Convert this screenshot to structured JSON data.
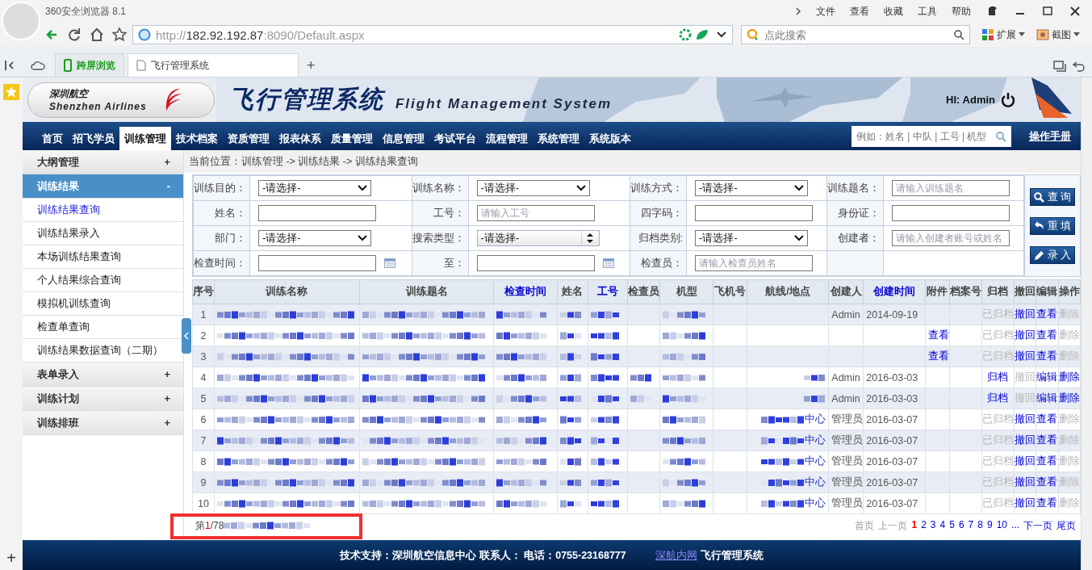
{
  "browser": {
    "title": "360安全浏览器 8.1",
    "menu": [
      "文件",
      "查看",
      "收藏",
      "工具",
      "帮助"
    ],
    "url": {
      "scheme": "http://",
      "host": "182.92.192.87",
      "rest": ":8090/Default.aspx"
    },
    "search": {
      "placeholder": "点此搜索"
    },
    "tools": [
      "扩展",
      "截图"
    ],
    "tabs": [
      {
        "label": "跨屏浏览",
        "kind": "special",
        "selected": false
      },
      {
        "label": "飞行管理系统",
        "kind": "page",
        "selected": true
      }
    ],
    "new_tab": "+",
    "side_plus": "+"
  },
  "header": {
    "logo_cn": "深圳航空",
    "logo_en": "Shenzhen Airlines",
    "title_cn": "飞行管理系统",
    "title_en": "Flight Management System",
    "greeting": "HI: Admin"
  },
  "nav": {
    "items": [
      {
        "label": "首页",
        "selected": false
      },
      {
        "label": "招飞学员",
        "selected": false
      },
      {
        "label": "训练管理",
        "selected": true
      },
      {
        "label": "技术档案",
        "selected": false
      },
      {
        "label": "资质管理",
        "selected": false
      },
      {
        "label": "报表体系",
        "selected": false
      },
      {
        "label": "质量管理",
        "selected": false
      },
      {
        "label": "信息管理",
        "selected": false
      },
      {
        "label": "考试平台",
        "selected": false
      },
      {
        "label": "流程管理",
        "selected": false
      },
      {
        "label": "系统管理",
        "selected": false
      },
      {
        "label": "系统版本",
        "selected": false
      }
    ],
    "search_placeholder": "例如：姓名 | 中队 | 工号 | 机型",
    "manual": "操作手册"
  },
  "sidebar": [
    {
      "label": "大纲管理",
      "sign": "+",
      "expanded": false
    },
    {
      "label": "训练结果",
      "sign": "-",
      "expanded": true,
      "children": [
        {
          "label": "训练结果查询",
          "selected": true
        },
        {
          "label": "训练结果录入",
          "selected": false
        },
        {
          "label": "本场训练结果查询",
          "selected": false
        },
        {
          "label": "个人结果综合查询",
          "selected": false
        },
        {
          "label": "模拟机训练查询",
          "selected": false
        },
        {
          "label": "检查单查询",
          "selected": false
        },
        {
          "label": "训练结果数据查询（二期）",
          "selected": false
        }
      ]
    },
    {
      "label": "表单录入",
      "sign": "+",
      "expanded": false
    },
    {
      "label": "训练计划",
      "sign": "+",
      "expanded": false
    },
    {
      "label": "训练排班",
      "sign": "+",
      "expanded": false
    }
  ],
  "breadcrumb": "当前位置：训练管理 -> 训练结果 -> 训练结果查询",
  "form": {
    "rows": [
      [
        {
          "label": "训练目的：",
          "kind": "select",
          "value": "-请选择-"
        },
        {
          "label": "训练名称：",
          "kind": "select",
          "value": "-请选择-"
        },
        {
          "label": "训练方式：",
          "kind": "select",
          "value": "-请选择-"
        },
        {
          "label": "训练题名：",
          "kind": "text",
          "placeholder": "请输入训练题名"
        }
      ],
      [
        {
          "label": "姓名：",
          "kind": "text"
        },
        {
          "label": "工号：",
          "kind": "text",
          "placeholder": "请输入工号"
        },
        {
          "label": "四字码：",
          "kind": "text"
        },
        {
          "label": "身份证：",
          "kind": "text"
        }
      ],
      [
        {
          "label": "部门：",
          "kind": "select",
          "value": "-请选择-"
        },
        {
          "label": "搜索类型：",
          "kind": "spinner",
          "value": "-请选择-"
        },
        {
          "label": "归档类别:",
          "kind": "select",
          "value": "-请选择-"
        },
        {
          "label": "创建者：",
          "kind": "text",
          "placeholder": "请输入创建者账号或姓名"
        }
      ],
      [
        {
          "label": "检查时间：",
          "kind": "date"
        },
        {
          "label": "至：",
          "kind": "date"
        },
        {
          "label": "检查员：",
          "kind": "text",
          "placeholder": "请输入检查员姓名"
        }
      ]
    ],
    "buttons": [
      {
        "label": "查 询",
        "kind": "search"
      },
      {
        "label": "重 填",
        "kind": "reset"
      },
      {
        "label": "录 入",
        "kind": "edit"
      }
    ]
  },
  "table": {
    "columns": [
      {
        "label": "序号",
        "kind": "index",
        "link": false
      },
      {
        "label": "训练名称",
        "kind": "masked",
        "link": false
      },
      {
        "label": "训练题名",
        "kind": "masked",
        "link": false
      },
      {
        "label": "检查时间",
        "kind": "masked",
        "link": true
      },
      {
        "label": "姓名",
        "kind": "masked",
        "link": false
      },
      {
        "label": "工号",
        "kind": "masked",
        "link": true
      },
      {
        "label": "检查员",
        "kind": "inspector",
        "link": false
      },
      {
        "label": "机型",
        "kind": "masked",
        "link": false
      },
      {
        "label": "飞机号",
        "kind": "empty",
        "link": false
      },
      {
        "label": "航线/地点",
        "kind": "route",
        "link": false
      },
      {
        "label": "创建人",
        "kind": "creator",
        "link": false
      },
      {
        "label": "创建时间",
        "kind": "created",
        "link": true
      },
      {
        "label": "附件",
        "kind": "attachment",
        "link": false
      },
      {
        "label": "档案号",
        "kind": "empty",
        "link": false
      },
      {
        "label": "归档",
        "kind": "archive",
        "link": false
      },
      {
        "label": "撤回",
        "kind": "revoke",
        "link": false
      },
      {
        "label": "编辑",
        "kind": "edit",
        "link": false
      },
      {
        "label": "操作",
        "kind": "delete",
        "link": false
      }
    ],
    "rows": [
      {
        "no": "1",
        "inspector_masked": false,
        "route_masked": false,
        "creator": "Admin",
        "created": "2014-09-19",
        "archive": "已归档",
        "archive_enabled": false,
        "revoke": "撤回",
        "revoke_enabled": true,
        "edit": "查看",
        "delete": "删除",
        "delete_enabled": false
      },
      {
        "no": "2",
        "inspector_masked": false,
        "route_masked": false,
        "attachment": "查看",
        "archive": "已归档",
        "archive_enabled": false,
        "revoke": "撤回",
        "revoke_enabled": true,
        "edit": "查看",
        "delete": "删除",
        "delete_enabled": false
      },
      {
        "no": "3",
        "inspector_masked": false,
        "route_masked": false,
        "attachment": "查看",
        "archive": "已归档",
        "archive_enabled": false,
        "revoke": "撤回",
        "revoke_enabled": true,
        "edit": "查看",
        "delete": "删除",
        "delete_enabled": false
      },
      {
        "no": "4",
        "inspector_masked": true,
        "route_masked": true,
        "creator": "Admin",
        "created": "2016-03-03",
        "archive": "归档",
        "archive_enabled": true,
        "revoke": "撤回",
        "revoke_enabled": false,
        "edit": "编辑",
        "delete": "删除",
        "delete_enabled": true
      },
      {
        "no": "5",
        "inspector_masked": true,
        "route_masked": true,
        "creator": "Admin",
        "created": "2016-03-03",
        "archive": "归档",
        "archive_enabled": true,
        "revoke": "撤回",
        "revoke_enabled": false,
        "edit": "编辑",
        "delete": "删除",
        "delete_enabled": true
      },
      {
        "no": "6",
        "inspector_masked": false,
        "route_masked": true,
        "route": "中心",
        "creator": "管理员",
        "created": "2016-03-07",
        "archive": "已归档",
        "archive_enabled": false,
        "revoke": "撤回",
        "revoke_enabled": true,
        "edit": "查看",
        "delete": "删除",
        "delete_enabled": false
      },
      {
        "no": "7",
        "inspector_masked": false,
        "route_masked": true,
        "route": "中心",
        "creator": "管理员",
        "created": "2016-03-07",
        "archive": "已归档",
        "archive_enabled": false,
        "revoke": "撤回",
        "revoke_enabled": true,
        "edit": "查看",
        "delete": "删除",
        "delete_enabled": false
      },
      {
        "no": "8",
        "inspector_masked": false,
        "route_masked": true,
        "route": "中心",
        "creator": "管理员",
        "created": "2016-03-07",
        "archive": "已归档",
        "archive_enabled": false,
        "revoke": "撤回",
        "revoke_enabled": true,
        "edit": "查看",
        "delete": "删除",
        "delete_enabled": false
      },
      {
        "no": "9",
        "inspector_masked": false,
        "route_masked": true,
        "route": "中心",
        "creator": "管理员",
        "created": "2016-03-07",
        "archive": "已归档",
        "archive_enabled": false,
        "revoke": "撤回",
        "revoke_enabled": true,
        "edit": "查看",
        "delete": "删除",
        "delete_enabled": false
      },
      {
        "no": "10",
        "inspector_masked": false,
        "route_masked": true,
        "route": "中心",
        "creator": "管理员",
        "created": "2016-03-07",
        "archive": "已归档",
        "archive_enabled": false,
        "revoke": "撤回",
        "revoke_enabled": true,
        "edit": "查看",
        "delete": "删除",
        "delete_enabled": false
      }
    ]
  },
  "pagination": {
    "prefix": "第",
    "current": "1",
    "total": "/78",
    "links": [
      {
        "label": "首页",
        "selected": false,
        "disabled": true
      },
      {
        "label": "上一页",
        "selected": false,
        "disabled": true
      },
      {
        "label": "1",
        "selected": true,
        "disabled": false
      },
      {
        "label": "2",
        "selected": false,
        "disabled": false
      },
      {
        "label": "3",
        "selected": false,
        "disabled": false
      },
      {
        "label": "4",
        "selected": false,
        "disabled": false
      },
      {
        "label": "5",
        "selected": false,
        "disabled": false
      },
      {
        "label": "6",
        "selected": false,
        "disabled": false
      },
      {
        "label": "7",
        "selected": false,
        "disabled": false
      },
      {
        "label": "8",
        "selected": false,
        "disabled": false
      },
      {
        "label": "9",
        "selected": false,
        "disabled": false
      },
      {
        "label": "10",
        "selected": false,
        "disabled": false
      },
      {
        "label": "...",
        "selected": false,
        "disabled": false
      },
      {
        "label": "下一页",
        "selected": false,
        "disabled": false
      },
      {
        "label": "尾页",
        "selected": false,
        "disabled": false
      }
    ]
  },
  "footer": {
    "support": "技术支持：深圳航空信息中心 联系人： 电话：0755-23168777",
    "link": "深航内网",
    "system": "飞行管理系统"
  }
}
